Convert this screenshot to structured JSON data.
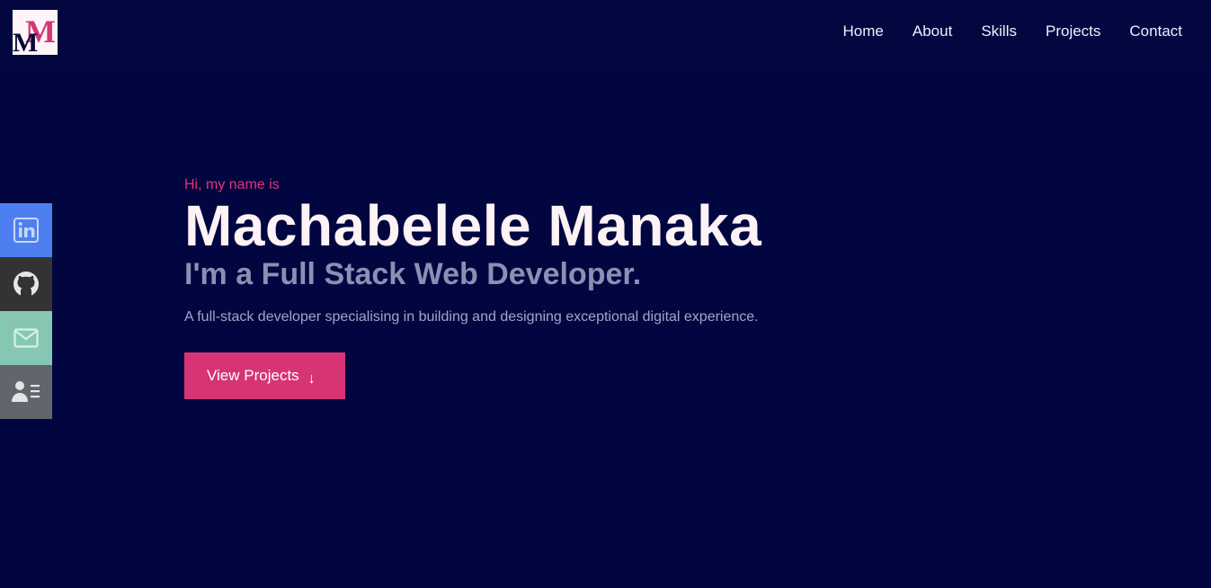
{
  "brand": {
    "logo_text": "MM",
    "colors": {
      "background": "#020640",
      "accent": "#e0337a",
      "button": "#d63474"
    }
  },
  "nav": {
    "items": [
      {
        "label": "Home"
      },
      {
        "label": "About"
      },
      {
        "label": "Skills"
      },
      {
        "label": "Projects"
      },
      {
        "label": "Contact"
      }
    ]
  },
  "social": [
    {
      "name": "linkedin-icon",
      "color": "#4d7ff0"
    },
    {
      "name": "github-icon",
      "color": "#333333"
    },
    {
      "name": "email-icon",
      "color": "#86c7b4"
    },
    {
      "name": "resume-icon",
      "color": "#60666c"
    }
  ],
  "hero": {
    "greeting": "Hi, my name is",
    "name": "Machabelele Manaka",
    "role": "I'm a Full Stack Web Developer.",
    "description": "A full-stack developer specialising in building and designing exceptional digital experience.",
    "cta_label": "View Projects",
    "cta_icon": "arrow-down-icon"
  }
}
